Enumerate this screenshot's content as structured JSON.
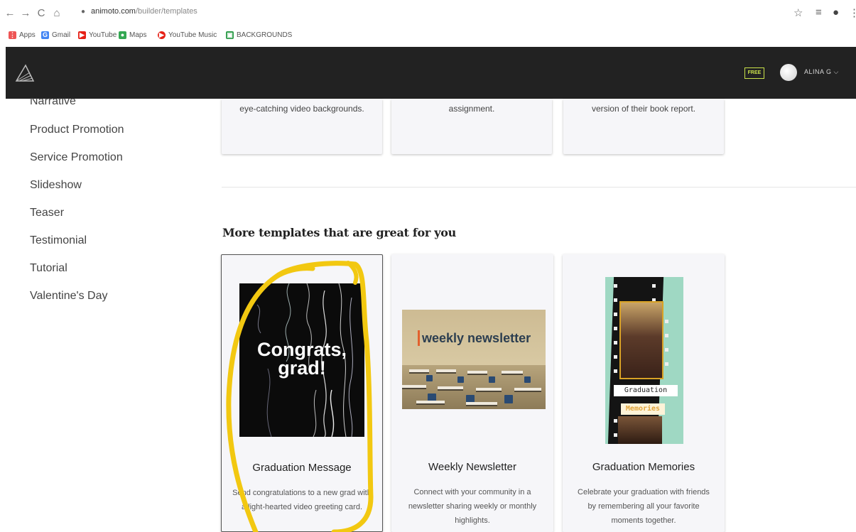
{
  "browser": {
    "url_host": "animoto.com",
    "url_path": "/builder/templates",
    "bookmarks": [
      {
        "label": "Apps",
        "icon": "apps-grid-icon",
        "color": "#e55"
      },
      {
        "label": "Gmail",
        "icon": "google-icon",
        "color": "#4285f4"
      },
      {
        "label": "YouTube",
        "icon": "youtube-icon",
        "color": "#e62117"
      },
      {
        "label": "Maps",
        "icon": "maps-pin-icon",
        "color": "#34a853"
      },
      {
        "label": "YouTube Music",
        "icon": "youtube-music-icon",
        "color": "#e62117"
      },
      {
        "label": "BACKGROUNDS",
        "icon": "image-icon",
        "color": "#2e9c4a"
      }
    ]
  },
  "header": {
    "free_badge": "FREE",
    "user_name": "ALINA G",
    "background": "#222222",
    "accent": "#c9e14a"
  },
  "sidebar": {
    "items": [
      {
        "label": "Narrative"
      },
      {
        "label": "Product Promotion"
      },
      {
        "label": "Service Promotion"
      },
      {
        "label": "Slideshow"
      },
      {
        "label": "Teaser"
      },
      {
        "label": "Testimonial"
      },
      {
        "label": "Tutorial"
      },
      {
        "label": "Valentine's Day"
      }
    ]
  },
  "top_cards": [
    {
      "desc": "eye-catching video backgrounds."
    },
    {
      "desc": "assignment."
    },
    {
      "desc": "version of their book report."
    }
  ],
  "section_title": "More templates that are great for you",
  "templates": [
    {
      "title": "Graduation Message",
      "description": "Send congratulations to a new grad with a light-hearted video greeting card.",
      "thumb_text": "Congrats, grad!"
    },
    {
      "title": "Weekly Newsletter",
      "description": "Connect with your community in a newsletter sharing weekly or monthly highlights.",
      "thumb_text": "weekly newsletter"
    },
    {
      "title": "Graduation Memories",
      "description": "Celebrate your graduation with friends by remembering all your favorite moments together.",
      "thumb_tag_1": "Graduation",
      "thumb_tag_2": "Memories"
    }
  ],
  "annotation_color": "#f2c811"
}
